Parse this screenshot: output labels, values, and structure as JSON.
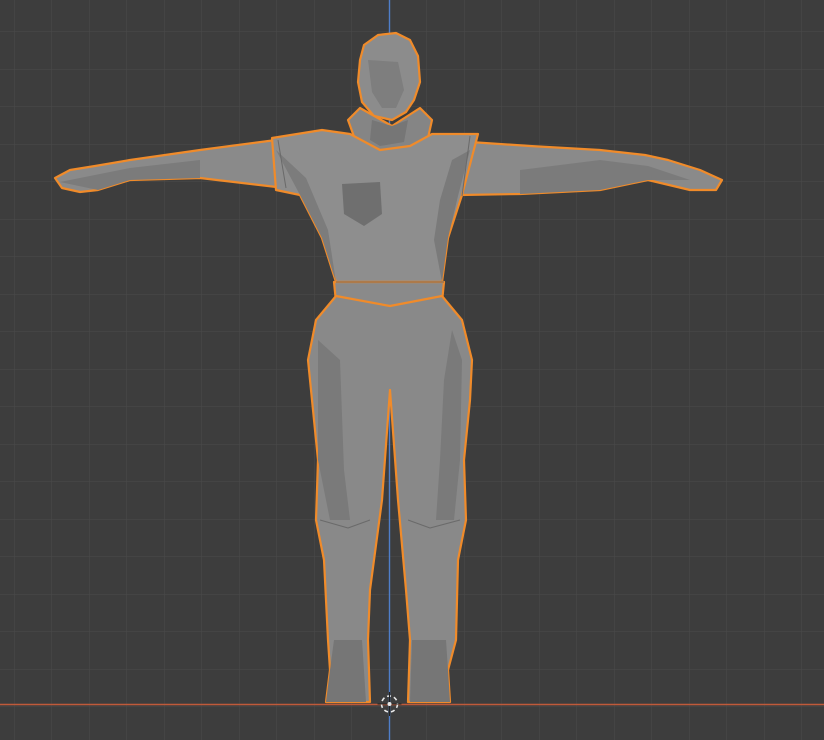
{
  "viewport": {
    "view": "front-orthographic",
    "object_selected": true
  },
  "colors": {
    "background": "#3d3d3d",
    "grid_line": "#4a4a4a",
    "z_axis": "#4f7ec9",
    "x_axis": "#c05a3a",
    "selection_outline": "#f08b2a",
    "mesh_fill": "#8c8c8c",
    "mesh_shade": "#7a7a7a",
    "mesh_dark": "#6c6c6c",
    "cursor": "#e8e8e8"
  },
  "icons": {
    "origin_marker": "3d-cursor-icon"
  }
}
